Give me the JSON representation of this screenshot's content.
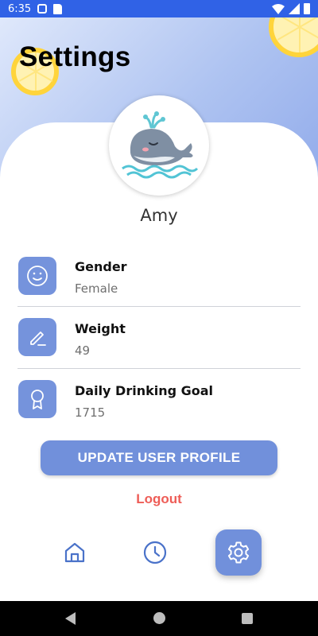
{
  "status_bar": {
    "time": "6:35"
  },
  "header": {
    "title": "Settings"
  },
  "profile": {
    "name": "Amy"
  },
  "fields": [
    {
      "label": "Gender",
      "value": "Female",
      "icon": "smile-icon"
    },
    {
      "label": "Weight",
      "value": "49",
      "icon": "pencil-icon"
    },
    {
      "label": "Daily Drinking Goal",
      "value": "1715",
      "icon": "award-ribbon-icon"
    }
  ],
  "actions": {
    "update_label": "UPDATE USER PROFILE",
    "logout_label": "Logout"
  },
  "bottom_nav": [
    {
      "name": "home",
      "icon": "home-icon",
      "active": false
    },
    {
      "name": "history",
      "icon": "clock-icon",
      "active": false
    },
    {
      "name": "settings",
      "icon": "gear-icon",
      "active": true
    }
  ],
  "colors": {
    "accent": "#7190db",
    "icon_tile": "#7593dc",
    "logout": "#ee5d57",
    "nav_icon": "#4a72c9",
    "status_bar": "#3062e6"
  }
}
